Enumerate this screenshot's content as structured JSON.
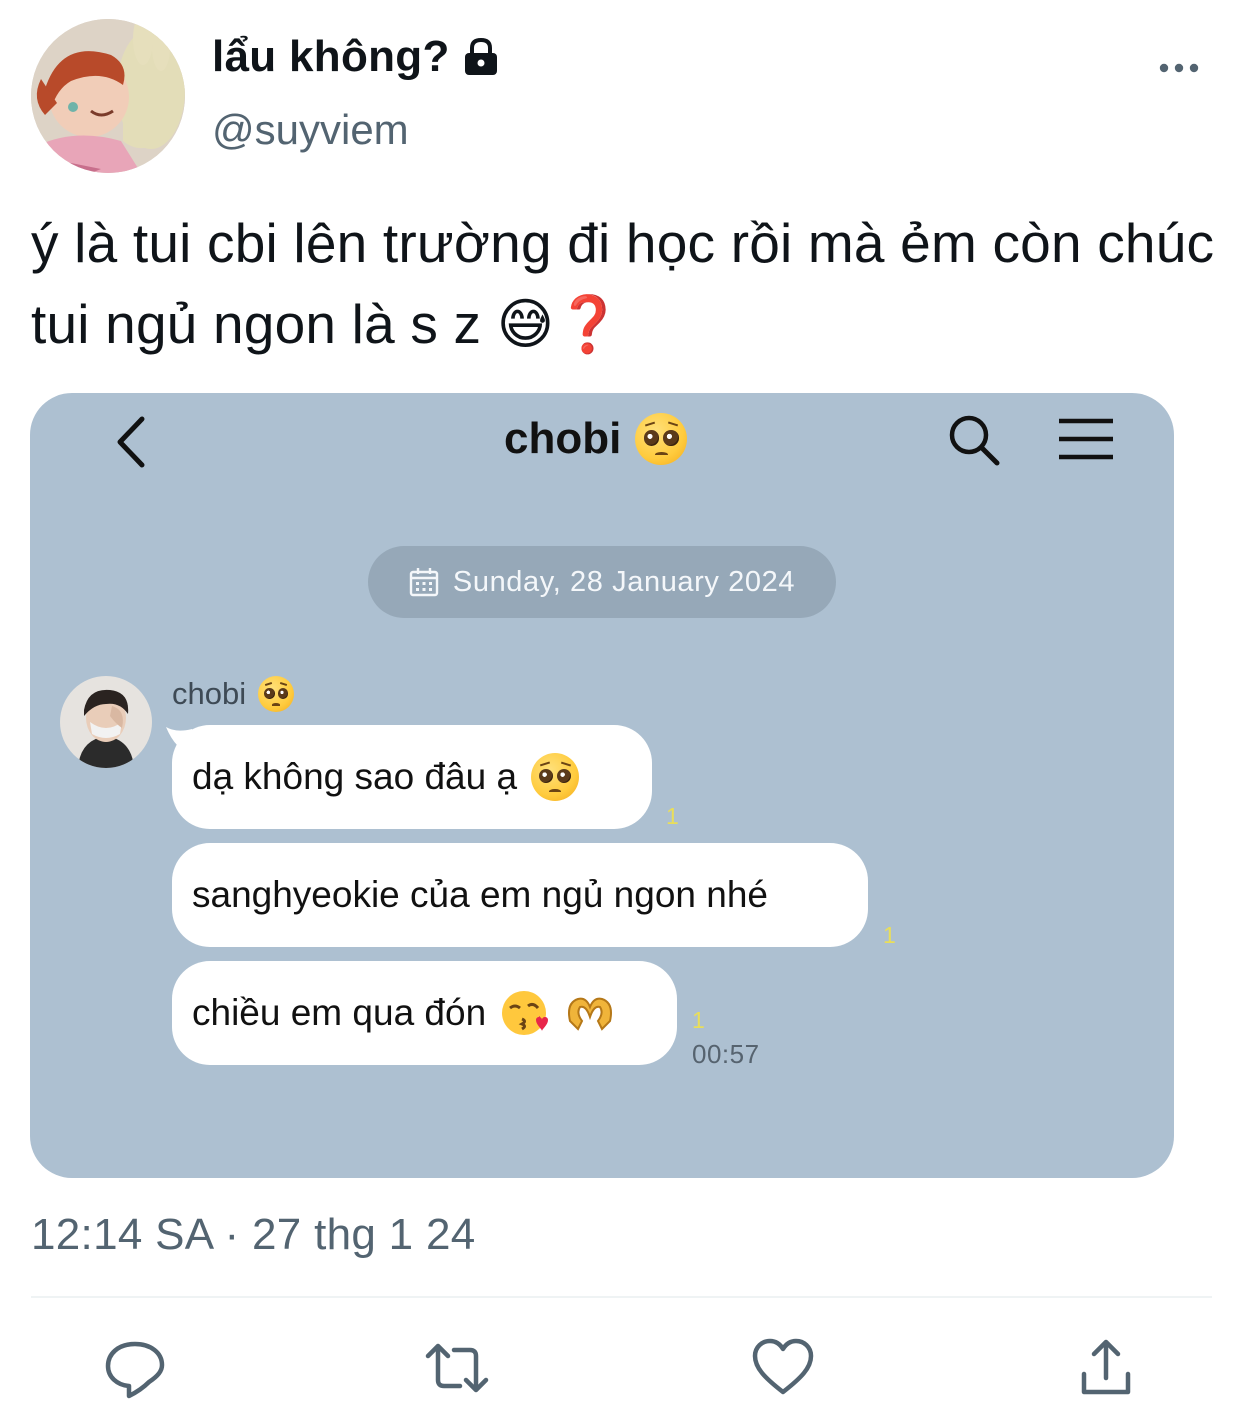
{
  "author": {
    "display_name": "lẩu không?",
    "handle": "@suyviem",
    "protected": true
  },
  "icons": {
    "lock": "lock-icon",
    "more": "more-horizontal-icon",
    "reply": "reply-icon",
    "retweet": "retweet-icon",
    "like": "heart-icon",
    "share": "share-icon"
  },
  "tweet": {
    "text": "ý là tui cbi lên trường đi học rồi mà ẻm còn chúc tui ngủ ngon là s z 😅❓",
    "timestamp": "12:14 SA · 27 thg 1 24"
  },
  "chat": {
    "title": "chobi",
    "date_label": "Sunday, 28 January 2024",
    "sender_name": "chobi",
    "messages": [
      {
        "text": "dạ không sao đâu ạ",
        "read": "1"
      },
      {
        "text": "sanghyeokie của em ngủ ngon nhé",
        "read": "1"
      },
      {
        "text": "chiều em qua đón",
        "read": "1",
        "time": "00:57"
      }
    ],
    "background_color": "#adc0d1",
    "bubble_color": "#ffffff",
    "read_color": "#e9de5a"
  }
}
